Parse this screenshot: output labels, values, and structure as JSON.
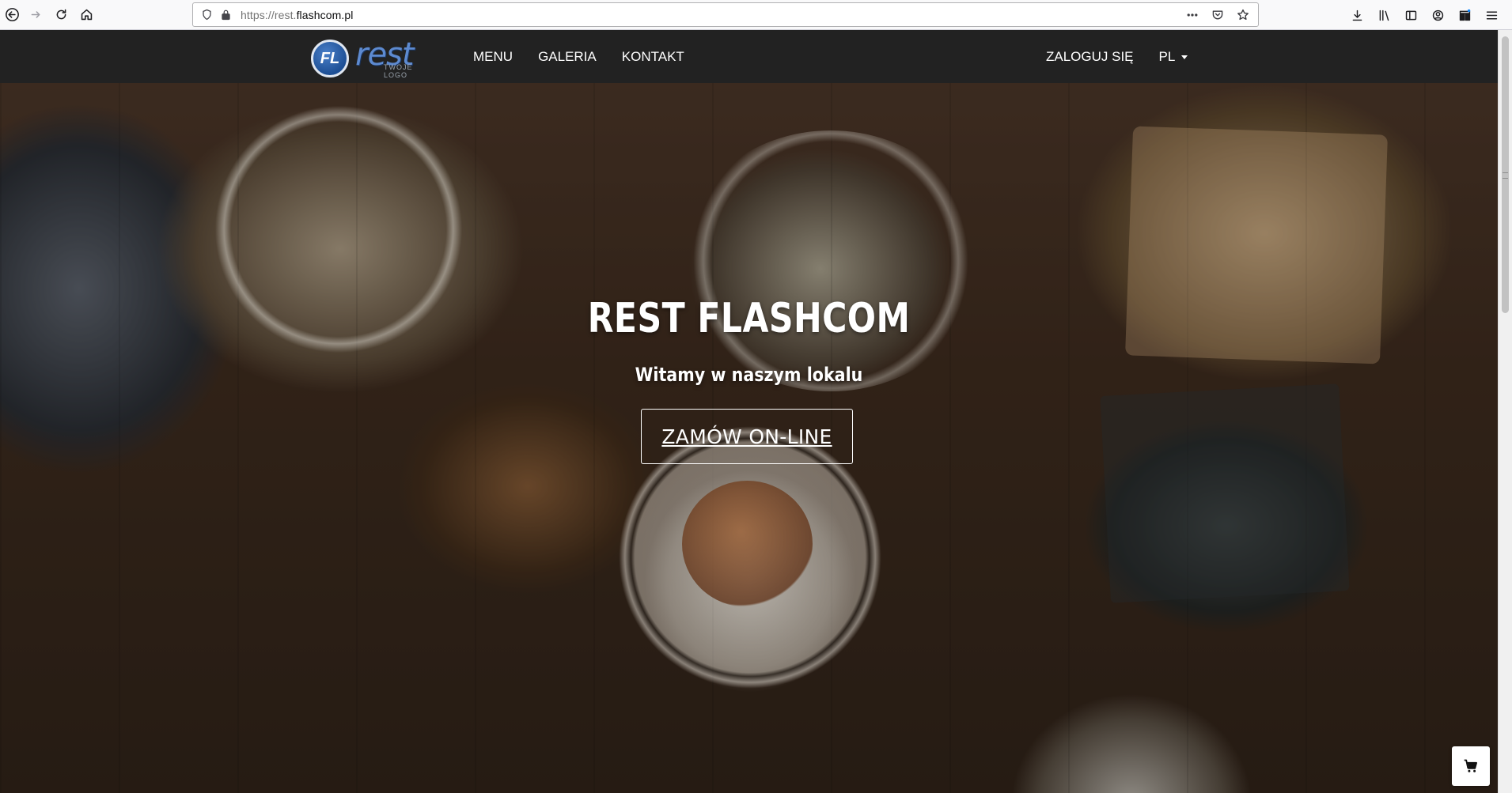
{
  "browser": {
    "url_prefix": "https://rest.",
    "url_host": "flashcom.pl"
  },
  "nav": {
    "logo_text": "rest",
    "logo_badge": "FL",
    "logo_tagline": "TWOJE LOGO",
    "links": [
      "MENU",
      "GALERIA",
      "KONTAKT"
    ],
    "login": "ZALOGUJ SIĘ",
    "language": "PL"
  },
  "hero": {
    "title": "REST FLASHCOM",
    "subtitle": "Witamy w naszym lokalu",
    "button": "ZAMÓW ON-LINE"
  },
  "icons": {
    "back": "back-arrow-icon",
    "forward": "forward-arrow-icon",
    "reload": "reload-icon",
    "home": "home-icon",
    "cart": "shopping-cart-icon"
  },
  "colors": {
    "navbar": "#222222",
    "hero_text": "#ffffff",
    "logo_blue": "#5d8ad0"
  }
}
